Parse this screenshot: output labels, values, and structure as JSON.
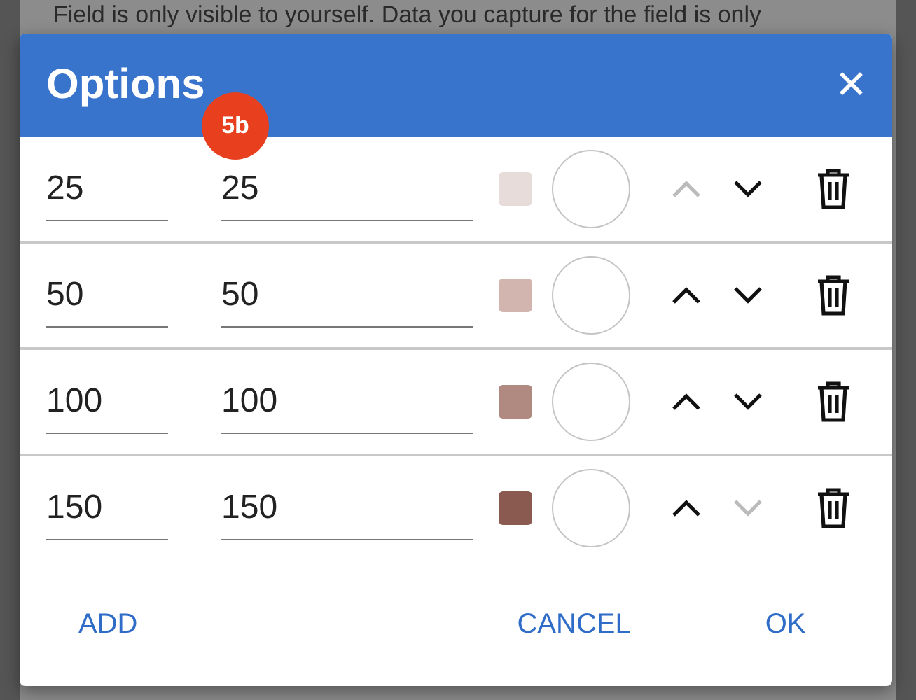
{
  "background": {
    "text": "Field is only visible to yourself. Data you capture for the field is only"
  },
  "dialog": {
    "title": "Options",
    "close": "✕",
    "badge": "5b",
    "rows": [
      {
        "value": "25",
        "label": "25",
        "color": "#e8dcda",
        "up_disabled": true,
        "down_disabled": false
      },
      {
        "value": "50",
        "label": "50",
        "color": "#d2b5ae",
        "up_disabled": false,
        "down_disabled": false
      },
      {
        "value": "100",
        "label": "100",
        "color": "#b08a80",
        "up_disabled": false,
        "down_disabled": false
      },
      {
        "value": "150",
        "label": "150",
        "color": "#8a5a50",
        "up_disabled": false,
        "down_disabled": true
      }
    ],
    "buttons": {
      "add": "ADD",
      "cancel": "CANCEL",
      "ok": "OK"
    }
  }
}
